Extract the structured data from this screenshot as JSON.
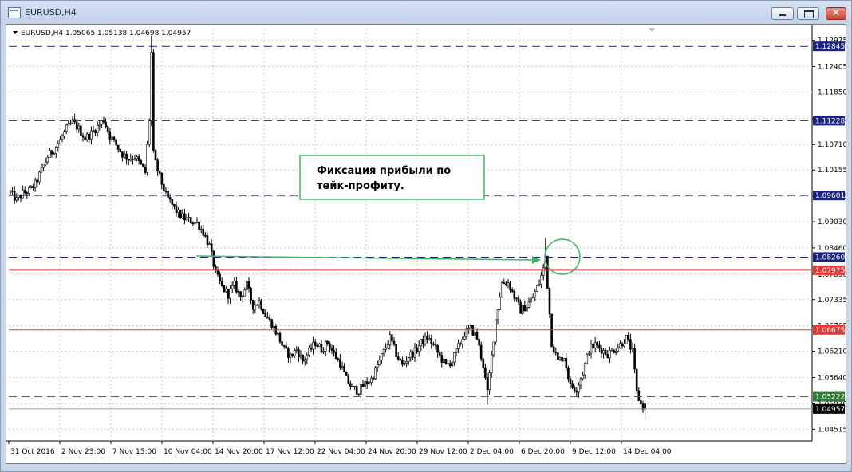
{
  "window": {
    "title": "EURUSD,H4",
    "minimize_glyph": "",
    "maximize_glyph": "",
    "close_glyph": "✕"
  },
  "chart_header": {
    "label": "EURUSD,H4  1.05065 1.05138 1.04698 1.04957"
  },
  "annotation": {
    "line1": "Фиксация прибыли по",
    "line2": "тейк-профиту."
  },
  "colors": {
    "bull_body": "#ffffff",
    "bear_body": "#000000",
    "wick": "#000000",
    "grid": "#c8c8c8",
    "navy_level": "#1a237e",
    "red_level": "#e53935",
    "green_level": "#2e7d32",
    "annotation_green": "#3dba63"
  },
  "chart_data": {
    "type": "candlestick",
    "symbol": "EURUSD",
    "timeframe": "H4",
    "title": "EURUSD,H4",
    "ylim": [
      1.0426,
      1.1323
    ],
    "y_ticks": [
      "1.12975",
      "1.12405",
      "1.11850",
      "1.11280",
      "1.10710",
      "1.10155",
      "1.09585",
      "1.09030",
      "1.08460",
      "1.07890",
      "1.07335",
      "1.06765",
      "1.06210",
      "1.05640",
      "1.05070",
      "1.04515"
    ],
    "x_ticks": [
      "31 Oct 2016",
      "2 Nov 23:00",
      "7 Nov 15:00",
      "10 Nov 04:00",
      "14 Nov 20:00",
      "17 Nov 12:00",
      "22 Nov 04:00",
      "24 Nov 20:00",
      "29 Nov 12:00",
      "2 Dec 04:00",
      "6 Dec 20:00",
      "9 Dec 12:00",
      "14 Dec 04:00"
    ],
    "grid": true,
    "levels": [
      {
        "price": 1.12845,
        "label": "1.12845",
        "style": "dashed",
        "color": "#1a237e"
      },
      {
        "price": 1.11228,
        "label": "1.11228",
        "style": "dashed",
        "color": "#1a237e"
      },
      {
        "price": 1.09601,
        "label": "1.09601",
        "style": "dashed",
        "color": "#1a237e"
      },
      {
        "price": 1.0826,
        "label": "1.08260",
        "style": "dashed",
        "color": "#1a237e"
      },
      {
        "price": 1.07975,
        "label": "1.07975",
        "style": "solid",
        "color": "#e53935"
      },
      {
        "price": 1.06675,
        "label": "1.06675",
        "style": "solid",
        "color": "#e53935"
      },
      {
        "price": 1.05222,
        "label": "1.05222",
        "style": "dashed",
        "color": "#2e7d32"
      }
    ],
    "current_price": {
      "price": 1.04957,
      "label": "1.04957"
    },
    "path": [
      [
        0,
        1.0967
      ],
      [
        3,
        1.095
      ],
      [
        6,
        1.0965
      ],
      [
        9,
        1.097
      ],
      [
        12,
        1.0985
      ],
      [
        15,
        1.1015
      ],
      [
        18,
        1.1045
      ],
      [
        21,
        1.106
      ],
      [
        24,
        1.108
      ],
      [
        27,
        1.1105
      ],
      [
        30,
        1.112
      ],
      [
        33,
        1.1105
      ],
      [
        36,
        1.1085
      ],
      [
        39,
        1.1095
      ],
      [
        42,
        1.111
      ],
      [
        45,
        1.1125
      ],
      [
        48,
        1.109
      ],
      [
        51,
        1.107
      ],
      [
        54,
        1.105
      ],
      [
        57,
        1.104
      ],
      [
        60,
        1.1045
      ],
      [
        63,
        1.1025
      ],
      [
        65,
        1.101
      ],
      [
        67,
        1.1125
      ],
      [
        68,
        1.127
      ],
      [
        69,
        1.105
      ],
      [
        70,
        1.103
      ],
      [
        72,
        1.1
      ],
      [
        75,
        1.096
      ],
      [
        78,
        1.094
      ],
      [
        81,
        1.092
      ],
      [
        84,
        1.091
      ],
      [
        87,
        1.0905
      ],
      [
        90,
        1.09
      ],
      [
        93,
        1.088
      ],
      [
        96,
        1.085
      ],
      [
        99,
        1.079
      ],
      [
        102,
        1.076
      ],
      [
        105,
        1.0745
      ],
      [
        108,
        1.0765
      ],
      [
        111,
        1.074
      ],
      [
        114,
        1.0765
      ],
      [
        117,
        1.072
      ],
      [
        120,
        1.073
      ],
      [
        123,
        1.07
      ],
      [
        126,
        1.068
      ],
      [
        129,
        1.0655
      ],
      [
        132,
        1.0625
      ],
      [
        135,
        1.061
      ],
      [
        138,
        1.0625
      ],
      [
        141,
        1.06
      ],
      [
        144,
        1.062
      ],
      [
        147,
        1.064
      ],
      [
        150,
        1.0625
      ],
      [
        153,
        1.064
      ],
      [
        156,
        1.0615
      ],
      [
        159,
        1.0595
      ],
      [
        162,
        1.056
      ],
      [
        165,
        1.054
      ],
      [
        168,
        1.0535
      ],
      [
        171,
        1.055
      ],
      [
        174,
        1.056
      ],
      [
        177,
        1.059
      ],
      [
        180,
        1.062
      ],
      [
        183,
        1.065
      ],
      [
        186,
        1.0615
      ],
      [
        189,
        1.059
      ],
      [
        192,
        1.061
      ],
      [
        195,
        1.062
      ],
      [
        198,
        1.064
      ],
      [
        201,
        1.065
      ],
      [
        204,
        1.0635
      ],
      [
        207,
        1.061
      ],
      [
        210,
        1.059
      ],
      [
        213,
        1.06
      ],
      [
        216,
        1.063
      ],
      [
        219,
        1.066
      ],
      [
        222,
        1.067
      ],
      [
        225,
        1.065
      ],
      [
        228,
        1.059
      ],
      [
        230,
        1.053
      ],
      [
        232,
        1.061
      ],
      [
        234,
        1.069
      ],
      [
        237,
        1.077
      ],
      [
        240,
        1.077
      ],
      [
        243,
        1.074
      ],
      [
        246,
        1.071
      ],
      [
        249,
        1.072
      ],
      [
        252,
        1.074
      ],
      [
        255,
        1.077
      ],
      [
        257,
        1.08
      ],
      [
        258,
        1.0828
      ],
      [
        259,
        1.0765
      ],
      [
        261,
        1.064
      ],
      [
        264,
        1.06
      ],
      [
        267,
        1.061
      ],
      [
        270,
        1.0545
      ],
      [
        273,
        1.054
      ],
      [
        276,
        1.0575
      ],
      [
        279,
        1.0625
      ],
      [
        282,
        1.0635
      ],
      [
        285,
        1.0625
      ],
      [
        288,
        1.0615
      ],
      [
        291,
        1.0625
      ],
      [
        294,
        1.0635
      ],
      [
        297,
        1.065
      ],
      [
        300,
        1.062
      ],
      [
        302,
        1.053
      ],
      [
        304,
        1.0505
      ],
      [
        306,
        1.0496
      ]
    ]
  }
}
